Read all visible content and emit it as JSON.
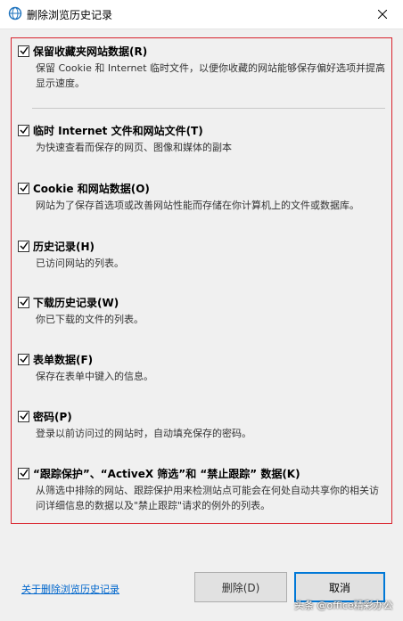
{
  "window": {
    "title": "删除浏览历史记录",
    "close_glyph": "✕"
  },
  "options": [
    {
      "label": "保留收藏夹网站数据(R)",
      "desc": "保留 Cookie 和 Internet 临时文件，以便你收藏的网站能够保存偏好选项并提高显示速度。",
      "checked": true
    },
    {
      "label": "临时 Internet 文件和网站文件(T)",
      "desc": "为快速查看而保存的网页、图像和媒体的副本",
      "checked": true
    },
    {
      "label": "Cookie 和网站数据(O)",
      "desc": "网站为了保存首选项或改善网站性能而存储在你计算机上的文件或数据库。",
      "checked": true
    },
    {
      "label": "历史记录(H)",
      "desc": "已访问网站的列表。",
      "checked": true
    },
    {
      "label": "下载历史记录(W)",
      "desc": "你已下载的文件的列表。",
      "checked": true
    },
    {
      "label": "表单数据(F)",
      "desc": "保存在表单中键入的信息。",
      "checked": true
    },
    {
      "label": "密码(P)",
      "desc": "登录以前访问过的网站时，自动填充保存的密码。",
      "checked": true
    },
    {
      "label": "“跟踪保护”、“ActiveX 筛选”和 “禁止跟踪” 数据(K)",
      "desc": "从筛选中排除的网站、跟踪保护用来检测站点可能会在何处自动共享你的相关访问详细信息的数据以及\"禁止跟踪\"请求的例外的列表。",
      "checked": true
    }
  ],
  "footer": {
    "link": "关于删除浏览历史记录",
    "delete_label": "删除(D)",
    "cancel_label": "取消"
  },
  "watermark": "头条 @office精彩办公",
  "colors": {
    "highlight_border": "#d9232d",
    "link": "#0066cc",
    "focus_border": "#0078d7"
  }
}
